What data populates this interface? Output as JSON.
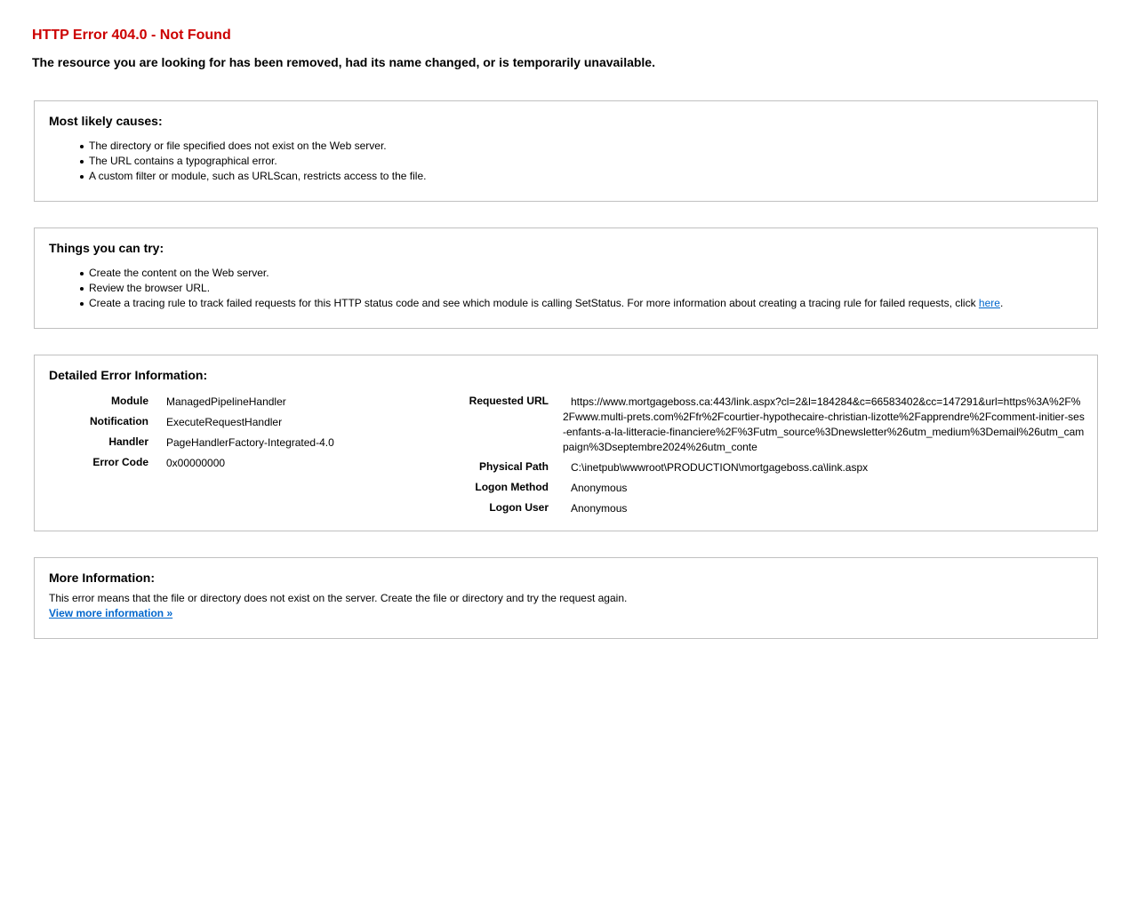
{
  "header": {
    "title": "HTTP Error 404.0 - Not Found",
    "subtitle": "The resource you are looking for has been removed, had its name changed, or is temporarily unavailable."
  },
  "causes": {
    "title": "Most likely causes:",
    "items": [
      "The directory or file specified does not exist on the Web server.",
      "The URL contains a typographical error.",
      "A custom filter or module, such as URLScan, restricts access to the file."
    ]
  },
  "try": {
    "title": "Things you can try:",
    "items": [
      "Create the content on the Web server.",
      "Review the browser URL."
    ],
    "tracing_text": "Create a tracing rule to track failed requests for this HTTP status code and see which module is calling SetStatus. For more information about creating a tracing rule for failed requests, click ",
    "tracing_link": "here",
    "tracing_end": "."
  },
  "details": {
    "title": "Detailed Error Information:",
    "left": [
      {
        "label": "Module",
        "value": "ManagedPipelineHandler"
      },
      {
        "label": "Notification",
        "value": "ExecuteRequestHandler"
      },
      {
        "label": "Handler",
        "value": "PageHandlerFactory-Integrated-4.0"
      },
      {
        "label": "Error Code",
        "value": "0x00000000"
      }
    ],
    "requested_url_label": "Requested URL",
    "requested_url_value": "https://www.mortgageboss.ca:443/link.aspx?cl=2&l=184284&c=66583402&cc=147291&url=https%3A%2F%2Fwww.multi-prets.com%2Ffr%2Fcourtier-hypothecaire-christian-lizotte%2Fapprendre%2Fcomment-initier-ses-enfants-a-la-litteracie-financiere%2F%3Futm_source%3Dnewsletter%26utm_medium%3Demail%26utm_campaign%3Dseptembre2024%26utm_conte",
    "right": [
      {
        "label": "Physical Path",
        "value": "C:\\inetpub\\wwwroot\\PRODUCTION\\mortgageboss.ca\\link.aspx"
      },
      {
        "label": "Logon Method",
        "value": "Anonymous"
      },
      {
        "label": "Logon User",
        "value": "Anonymous"
      }
    ]
  },
  "more": {
    "title": "More Information:",
    "text": "This error means that the file or directory does not exist on the server. Create the file or directory and try the request again.",
    "link": "View more information »"
  },
  "colors": {
    "title": "#cc0000",
    "link": "#0066cc",
    "box_border": "#c0c0c0"
  }
}
